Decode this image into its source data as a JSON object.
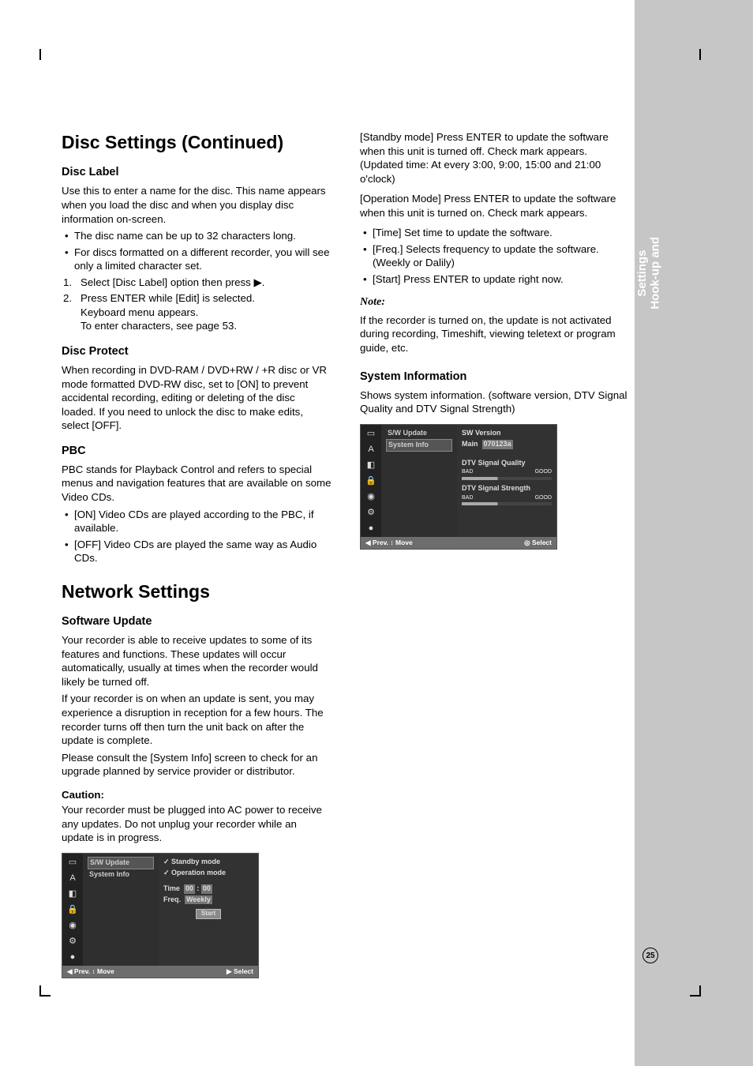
{
  "side_tab": {
    "line1": "Hook-up and",
    "line2": "Settings"
  },
  "page_number": "25",
  "col1": {
    "h1_disc": "Disc Settings (Continued)",
    "disc_label": {
      "heading": "Disc Label",
      "intro": "Use this to enter a name for the disc. This name appears when you load the disc and when you display disc information on-screen.",
      "b1": "The disc name can be up to 32 characters long.",
      "b2": "For discs formatted on a different recorder, you will see only a limited character set.",
      "s1": "Select [Disc Label] option then press ▶.",
      "s2a": "Press ENTER while [Edit] is selected.",
      "s2b": "Keyboard menu appears.",
      "s2c": "To enter characters, see page 53."
    },
    "disc_protect": {
      "heading": "Disc Protect",
      "body": "When recording in DVD-RAM / DVD+RW / +R disc or VR mode formatted DVD-RW disc, set to [ON] to prevent accidental recording, editing or deleting of the disc loaded. If you need to unlock the disc to make edits, select [OFF]."
    },
    "pbc": {
      "heading": "PBC",
      "intro": "PBC stands for Playback Control and refers to special menus and navigation features that are available on some Video CDs.",
      "b1": "[ON] Video CDs are played according to the PBC, if available.",
      "b2": "[OFF] Video CDs are played the same way as Audio CDs."
    },
    "h1_net": "Network Settings",
    "sw_update": {
      "heading": "Software Update",
      "p1": "Your recorder is able to receive updates to some of its features and functions. These updates will occur automatically, usually at times when the recorder would likely be turned off.",
      "p2": "If your recorder is on when an update is sent, you may experience a disruption in reception for a few hours. The recorder turns off then turn the unit back on after the update is complete.",
      "p3": "Please consult the [System Info] screen to check for an upgrade planned by service provider or distributor.",
      "caution_h": "Caution:",
      "caution_b": "Your recorder must be plugged into AC power to receive any updates. Do not unplug your recorder while an update is in progress."
    },
    "osd1": {
      "menu1": "S/W Update",
      "menu2": "System Info",
      "r1": "Standby mode",
      "r2": "Operation mode",
      "time_l": "Time",
      "time_v1": "00",
      "time_v2": "00",
      "freq_l": "Freq.",
      "freq_v": "Weekly",
      "start": "Start",
      "foot_l": "◀ Prev.   ↕ Move",
      "foot_r": "▶ Select"
    }
  },
  "col2": {
    "p_standby": "[Standby mode] Press ENTER to update the software when this unit is turned off. Check mark appears. (Updated time: At every 3:00, 9:00, 15:00 and 21:00 o'clock)",
    "p_operation": "[Operation Mode] Press ENTER to update the software when this unit is turned on. Check mark appears.",
    "b_time": "[Time] Set time to update the software.",
    "b_freq": "[Freq.] Selects frequency to update the software. (Weekly or Dalily)",
    "b_start": "[Start] Press ENTER to update right now.",
    "note_h": "Note:",
    "note_b": "If the recorder is turned on, the update is not activated during recording, Timeshift, viewing teletext or program guide, etc.",
    "sysinfo_h": "System Information",
    "sysinfo_b": "Shows system information. (software version, DTV Signal Quality and DTV Signal Strength)",
    "osd2": {
      "menu1": "S/W Update",
      "menu2": "System Info",
      "sw_h": "SW Version",
      "sw_l": "Main",
      "sw_v": "070123a",
      "q_h": "DTV Signal Quality",
      "q_b": "BAD",
      "q_g": "GOOD",
      "s_h": "DTV Signal Strength",
      "s_b": "BAD",
      "s_g": "GOOD",
      "foot_l": "◀ Prev.   ↕ Move",
      "foot_r": "◎ Select"
    }
  }
}
